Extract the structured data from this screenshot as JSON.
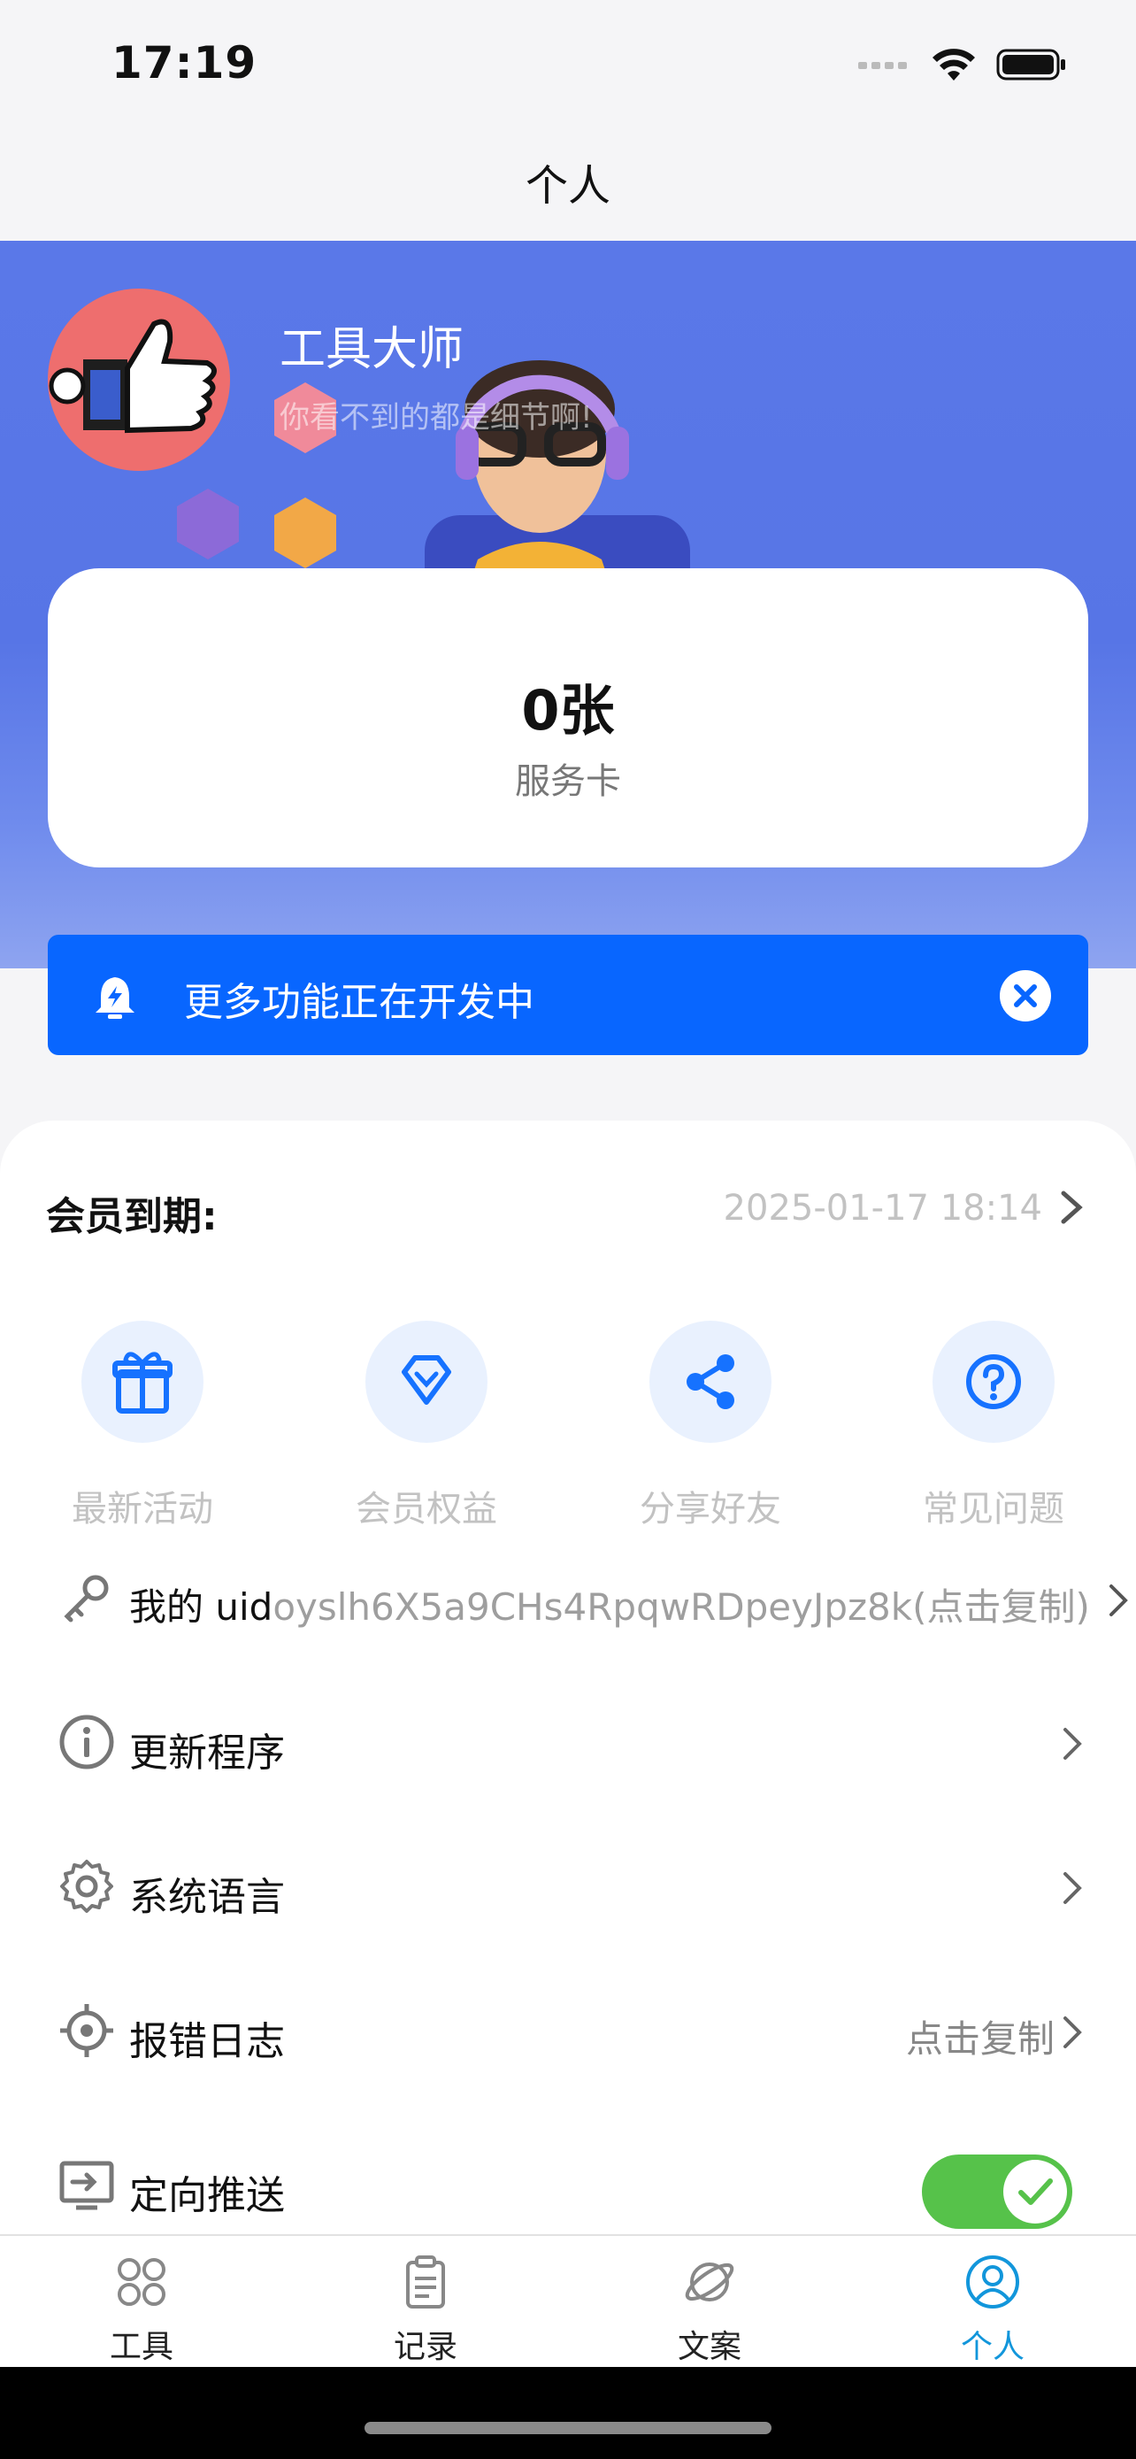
{
  "status_bar": {
    "time": "17:19"
  },
  "nav": {
    "title": "个人"
  },
  "profile": {
    "name": "工具大师",
    "slogan": "你看不到的都是细节啊!"
  },
  "card": {
    "count": "0张",
    "label": "服务卡"
  },
  "notice": {
    "text": "更多功能正在开发中"
  },
  "membership": {
    "label": "会员到期:",
    "date": "2025-01-17 18:14"
  },
  "features": [
    {
      "label": "最新活动",
      "icon": "gift-icon"
    },
    {
      "label": "会员权益",
      "icon": "diamond-icon"
    },
    {
      "label": "分享好友",
      "icon": "share-icon"
    },
    {
      "label": "常见问题",
      "icon": "question-icon"
    }
  ],
  "uid": {
    "label": "我的 uid",
    "value": "oyslh6X5a9CHs4RpqwRDpeyJpz8k(点击复制)"
  },
  "settings": {
    "update": {
      "label": "更新程序"
    },
    "language": {
      "label": "系统语言"
    },
    "error_log": {
      "label": "报错日志",
      "action": "点击复制"
    },
    "push": {
      "label": "定向推送",
      "enabled": true
    }
  },
  "tabs": [
    {
      "label": "工具",
      "icon": "grid-icon",
      "active": false
    },
    {
      "label": "记录",
      "icon": "clipboard-icon",
      "active": false
    },
    {
      "label": "文案",
      "icon": "planet-icon",
      "active": false
    },
    {
      "label": "个人",
      "icon": "user-icon",
      "active": true
    }
  ],
  "colors": {
    "primary": "#0866ff",
    "hero_bg": "#5a78e8",
    "toggle_on": "#56c24a",
    "tab_active": "#1296db"
  }
}
